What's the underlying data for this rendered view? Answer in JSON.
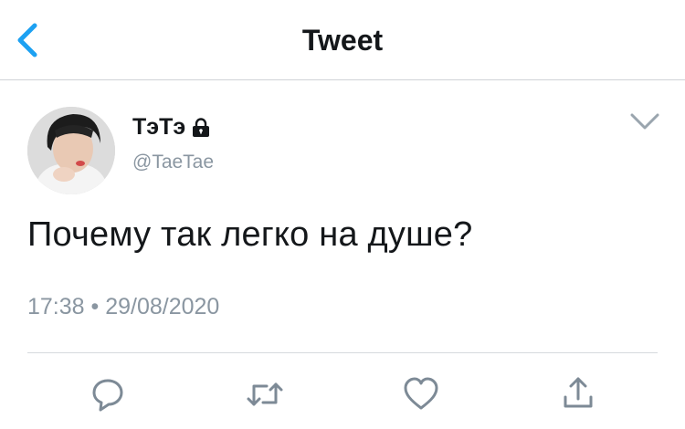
{
  "header": {
    "title": "Tweet",
    "back_icon": "chevron-left-icon"
  },
  "tweet": {
    "display_name": "ТэТэ",
    "locked_icon": "lock-icon",
    "handle": "@TaeTae",
    "text": "Почему так легко на душе?",
    "timestamp": "17:38 • 29/08/2020"
  },
  "actions": {
    "reply_icon": "reply-icon",
    "retweet_icon": "retweet-icon",
    "like_icon": "heart-icon",
    "share_icon": "share-icon"
  },
  "colors": {
    "accent": "#1da1f2",
    "secondary_text": "#8a96a1",
    "icon_gray": "#7d8a96",
    "divider": "#cfd3d6"
  }
}
